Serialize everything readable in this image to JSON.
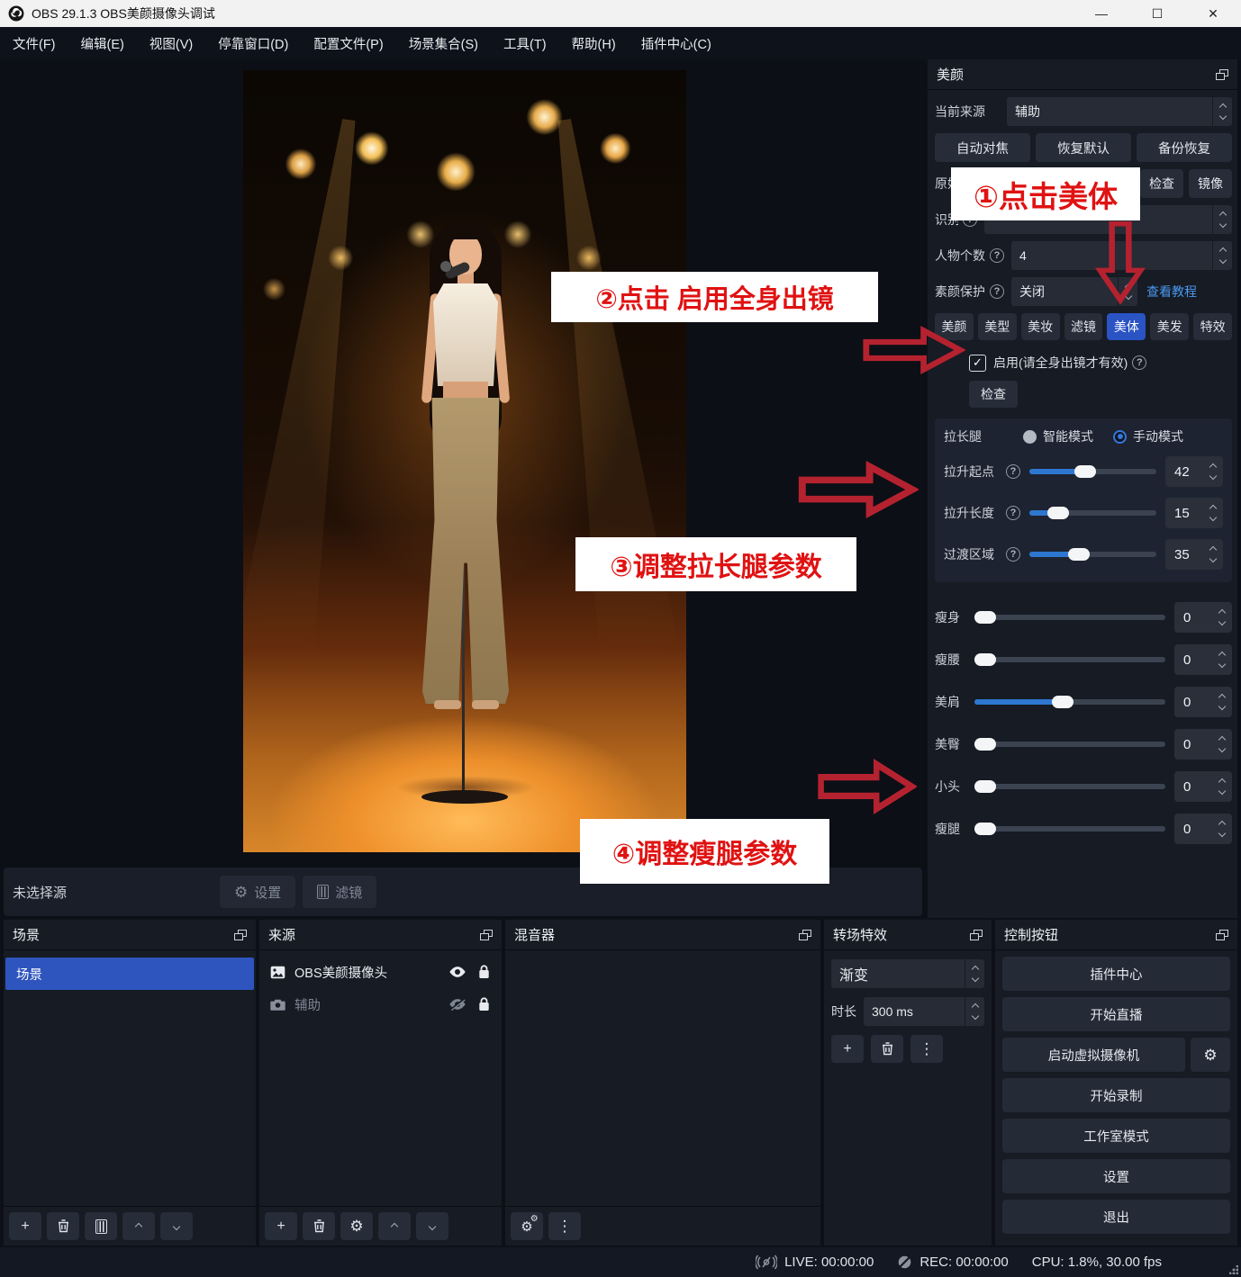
{
  "window": {
    "title": "OBS 29.1.3  OBS美颜摄像头调试",
    "minimize": "—",
    "maximize": "☐",
    "close": "✕"
  },
  "menu": {
    "items": [
      "文件(F)",
      "编辑(E)",
      "视图(V)",
      "停靠窗口(D)",
      "配置文件(P)",
      "场景集合(S)",
      "工具(T)",
      "帮助(H)",
      "插件中心(C)"
    ]
  },
  "beauty": {
    "title": "美颜",
    "current_source": {
      "label": "当前来源",
      "value": "辅助"
    },
    "action_buttons": [
      "自动对焦",
      "恢复默认",
      "备份恢复"
    ],
    "original_row": {
      "label": "原始",
      "check": "检查",
      "mirror": "镜像"
    },
    "recognize_row": {
      "label": "识别"
    },
    "person_count": {
      "label": "人物个数",
      "value": "4"
    },
    "makeup_protect": {
      "label": "素颜保护",
      "value": "关闭",
      "link": "查看教程"
    },
    "tabs": [
      {
        "label": "美颜"
      },
      {
        "label": "美型"
      },
      {
        "label": "美妆"
      },
      {
        "label": "滤镜"
      },
      {
        "label": "美体"
      },
      {
        "label": "美发"
      },
      {
        "label": "特效"
      }
    ],
    "active_tab": "美体",
    "enable": {
      "label": "启用(请全身出镜才有效)",
      "checked": true
    },
    "check_button": "检查",
    "leg": {
      "title": "拉长腿",
      "smart_mode": "智能模式",
      "manual_mode": "手动模式",
      "selected_mode": "手动模式",
      "sliders": [
        {
          "label": "拉升起点",
          "value": "42",
          "percent": 43
        },
        {
          "label": "拉升长度",
          "value": "15",
          "percent": 17
        },
        {
          "label": "过渡区域",
          "value": "35",
          "percent": 37
        }
      ]
    },
    "body_sliders": [
      {
        "label": "瘦身",
        "value": "0",
        "percent": 0
      },
      {
        "label": "瘦腰",
        "value": "0",
        "percent": 0
      },
      {
        "label": "美肩",
        "value": "0",
        "percent": 46
      },
      {
        "label": "美臀",
        "value": "0",
        "percent": 0
      },
      {
        "label": "小头",
        "value": "0",
        "percent": 0
      },
      {
        "label": "瘦腿",
        "value": "0",
        "percent": 0
      }
    ]
  },
  "annotations": {
    "step1": "①点击美体",
    "step2": "②点击 启用全身出镜",
    "step3": "③调整拉长腿参数",
    "step4": "④调整瘦腿参数"
  },
  "preview_bar": {
    "label": "未选择源",
    "settings": "设置",
    "filters": "滤镜"
  },
  "docks": {
    "scenes": {
      "title": "场景",
      "items": [
        {
          "name": "场景"
        }
      ]
    },
    "sources": {
      "title": "来源",
      "items": [
        {
          "name": "OBS美颜摄像头",
          "visible": true
        },
        {
          "name": "辅助",
          "visible": false
        }
      ]
    },
    "mixer": {
      "title": "混音器"
    },
    "transition": {
      "title": "转场特效",
      "value": "渐变",
      "duration_label": "时长",
      "duration_value": "300 ms"
    },
    "controls": {
      "title": "控制按钮",
      "buttons": [
        "插件中心",
        "开始直播",
        "启动虚拟摄像机",
        "开始录制",
        "工作室模式",
        "设置",
        "退出"
      ]
    }
  },
  "status": {
    "live": "LIVE: 00:00:00",
    "rec": "REC: 00:00:00",
    "cpu": "CPU: 1.8%, 30.00 fps"
  },
  "icons": {
    "gear": "⚙",
    "kebab": "⋮",
    "plus": "+",
    "mixer_gears": "⚙"
  },
  "colors": {
    "accent_blue": "#2a53c4",
    "selected_scene": "#2e54be",
    "annotation_red": "#e01212",
    "arrow_red": "#b5222f",
    "link_blue": "#4b9af0",
    "slider_fill": "#2e77d0"
  }
}
